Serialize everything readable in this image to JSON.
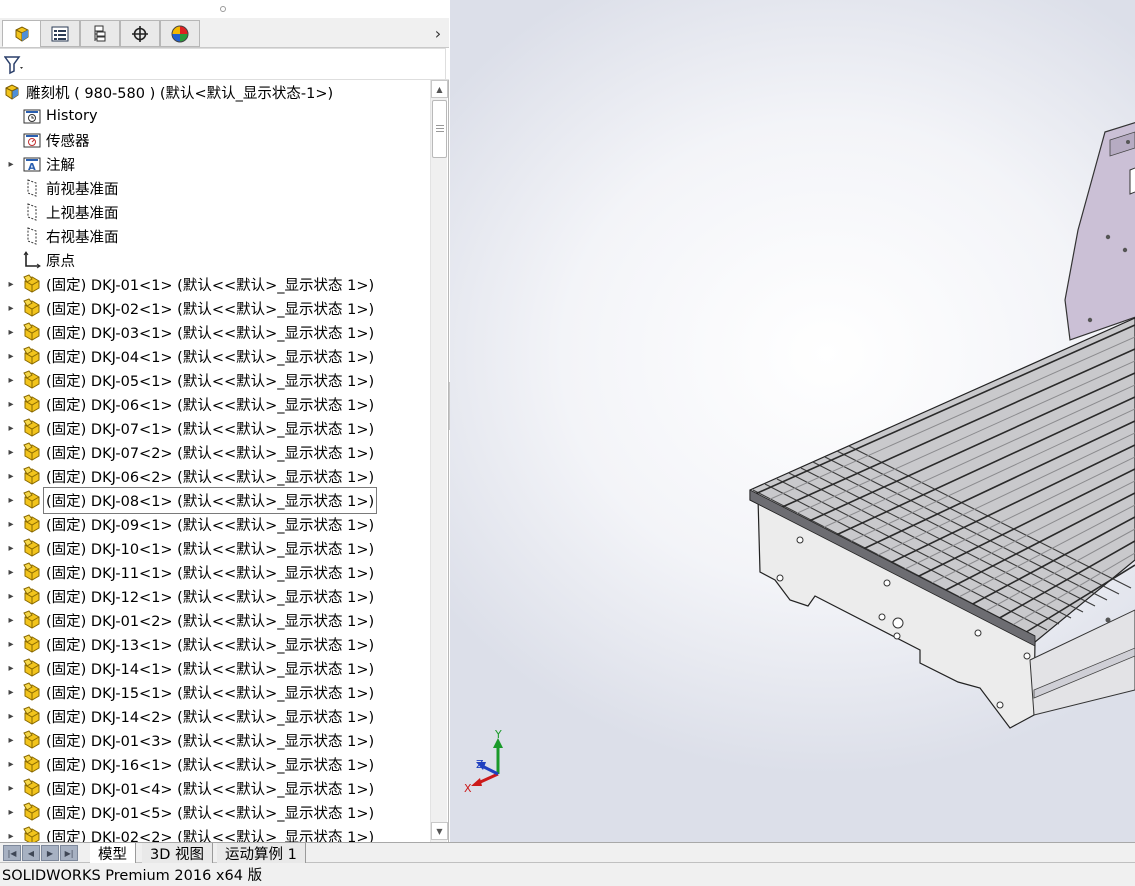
{
  "panel": {
    "tabs": [
      "feature-manager",
      "property-manager",
      "configuration-manager",
      "dimxpert-manager",
      "display-manager"
    ],
    "more_glyph": "›",
    "filter_icon": "filter-icon"
  },
  "tree": {
    "root": "雕刻机 ( 980-580 )  (默认<默认_显示状态-1>)",
    "fixed": [
      {
        "label": "History",
        "icon": "history-icon",
        "expandable": false
      },
      {
        "label": "传感器",
        "icon": "sensor-icon",
        "expandable": false
      },
      {
        "label": "注解",
        "icon": "annotation-icon",
        "expandable": true
      },
      {
        "label": "前视基准面",
        "icon": "plane-icon",
        "expandable": false
      },
      {
        "label": "上视基准面",
        "icon": "plane-icon",
        "expandable": false
      },
      {
        "label": "右视基准面",
        "icon": "plane-icon",
        "expandable": false
      },
      {
        "label": "原点",
        "icon": "origin-icon",
        "expandable": false
      }
    ],
    "components": [
      "(固定) DKJ-01<1> (默认<<默认>_显示状态 1>)",
      "(固定) DKJ-02<1> (默认<<默认>_显示状态 1>)",
      "(固定) DKJ-03<1> (默认<<默认>_显示状态 1>)",
      "(固定) DKJ-04<1> (默认<<默认>_显示状态 1>)",
      "(固定) DKJ-05<1> (默认<<默认>_显示状态 1>)",
      "(固定) DKJ-06<1> (默认<<默认>_显示状态 1>)",
      "(固定) DKJ-07<1> (默认<<默认>_显示状态 1>)",
      "(固定) DKJ-07<2> (默认<<默认>_显示状态 1>)",
      "(固定) DKJ-06<2> (默认<<默认>_显示状态 1>)",
      "(固定) DKJ-08<1> (默认<<默认>_显示状态 1>)",
      "(固定) DKJ-09<1> (默认<<默认>_显示状态 1>)",
      "(固定) DKJ-10<1> (默认<<默认>_显示状态 1>)",
      "(固定) DKJ-11<1> (默认<<默认>_显示状态 1>)",
      "(固定) DKJ-12<1> (默认<<默认>_显示状态 1>)",
      "(固定) DKJ-01<2> (默认<<默认>_显示状态 1>)",
      "(固定) DKJ-13<1> (默认<<默认>_显示状态 1>)",
      "(固定) DKJ-14<1> (默认<<默认>_显示状态 1>)",
      "(固定) DKJ-15<1> (默认<<默认>_显示状态 1>)",
      "(固定) DKJ-14<2> (默认<<默认>_显示状态 1>)",
      "(固定) DKJ-01<3> (默认<<默认>_显示状态 1>)",
      "(固定) DKJ-16<1> (默认<<默认>_显示状态 1>)",
      "(固定) DKJ-01<4> (默认<<默认>_显示状态 1>)",
      "(固定) DKJ-01<5> (默认<<默认>_显示状态 1>)",
      "(固定) DKJ-02<2> (默认<<默认>_显示状态 1>)"
    ],
    "selected_index": 9
  },
  "triad": {
    "x": "X",
    "y": "Y",
    "z": "Z"
  },
  "bottom_tabs": [
    "模型",
    "3D 视图",
    "运动算例 1"
  ],
  "active_bottom_tab": 0,
  "status": "SOLIDWORKS Premium 2016 x64 版",
  "colors": {
    "assembly_yellow": "#f2c41c",
    "plate_purple": "#cbc0d6",
    "plate_gray": "#ececec",
    "viewport_edge": "#dcdfe9"
  }
}
